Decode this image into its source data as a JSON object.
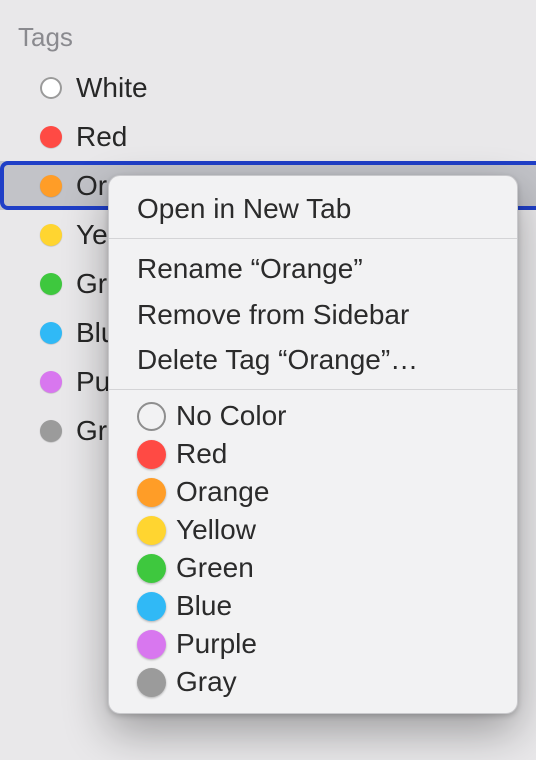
{
  "section_title": "Tags",
  "tags": [
    {
      "name": "white",
      "label": "White",
      "color": "#ffffff",
      "outline": true
    },
    {
      "name": "red",
      "label": "Red",
      "color": "#ff4a44"
    },
    {
      "name": "orange",
      "label": "Orange",
      "color": "#ff9d27",
      "selected": true
    },
    {
      "name": "yellow",
      "label": "Yellow",
      "color": "#ffd530"
    },
    {
      "name": "green",
      "label": "Green",
      "color": "#3ec83e"
    },
    {
      "name": "blue",
      "label": "Blue",
      "color": "#30b9f6"
    },
    {
      "name": "purple",
      "label": "Purple",
      "color": "#d877ef"
    },
    {
      "name": "grey",
      "label": "Grey",
      "color": "#9b9b9b"
    }
  ],
  "context_menu": {
    "open_new_tab": "Open in New Tab",
    "rename": "Rename “Orange”",
    "remove_sidebar": "Remove from Sidebar",
    "delete_tag": "Delete Tag “Orange”…",
    "colors": [
      {
        "name": "no-color",
        "label": "No Color",
        "nocolor": true
      },
      {
        "name": "red",
        "label": "Red",
        "color": "#ff4a44"
      },
      {
        "name": "orange",
        "label": "Orange",
        "color": "#ff9d27"
      },
      {
        "name": "yellow",
        "label": "Yellow",
        "color": "#ffd530"
      },
      {
        "name": "green",
        "label": "Green",
        "color": "#3ec83e"
      },
      {
        "name": "blue",
        "label": "Blue",
        "color": "#30b9f6"
      },
      {
        "name": "purple",
        "label": "Purple",
        "color": "#d877ef"
      },
      {
        "name": "gray",
        "label": "Gray",
        "color": "#9b9b9b"
      }
    ]
  }
}
